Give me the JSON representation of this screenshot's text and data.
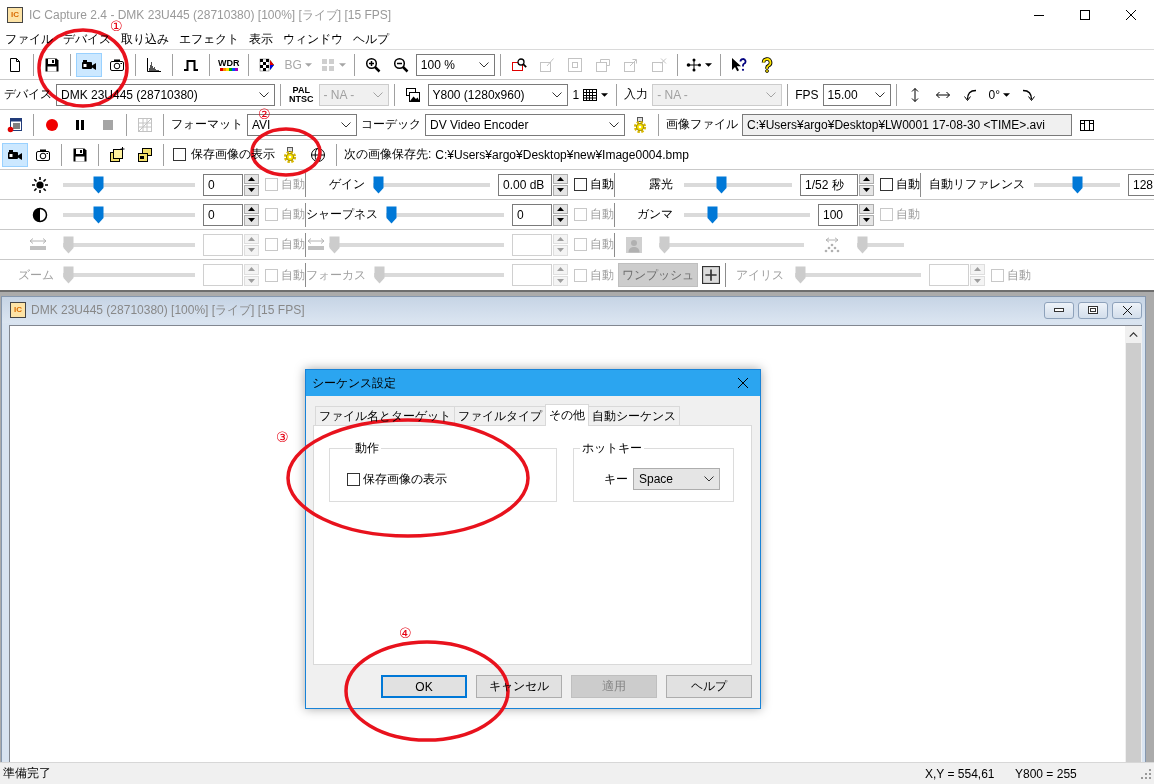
{
  "window": {
    "logo": "IC",
    "title": "IC Capture 2.4 - DMK 23U445 (28710380) [100%] [ライブ] [15 FPS]"
  },
  "menu": [
    "ファイル",
    "デバイス",
    "取り込み",
    "エフェクト",
    "表示",
    "ウィンドウ",
    "ヘルプ"
  ],
  "toolbars": [
    {
      "groups": [
        [
          {
            "kind": "icon_button",
            "selected": false,
            "disabled": false
          }
        ],
        [
          {
            "kind": "icon_button",
            "selected": false,
            "disabled": false
          }
        ],
        [
          {
            "kind": "icon_button",
            "selected": true,
            "disabled": false
          },
          {
            "kind": "icon_button",
            "selected": false,
            "disabled": false
          }
        ],
        [
          {
            "kind": "icon_button",
            "selected": false,
            "disabled": false
          }
        ],
        [
          {
            "kind": "icon_button",
            "selected": false,
            "disabled": false
          }
        ],
        [
          {
            "kind": "text_button",
            "lines": [
              "WDR"
            ],
            "disabled": false
          }
        ],
        [
          {
            "kind": "icon_button",
            "selected": false,
            "disabled": false
          },
          {
            "kind": "menu_button",
            "label": "BG",
            "disabled": true
          },
          {
            "kind": "menu_button",
            "disabled": true
          }
        ],
        [
          {
            "kind": "icon_button",
            "selected": false,
            "disabled": false
          },
          {
            "kind": "icon_button",
            "selected": false,
            "disabled": false
          },
          {
            "kind": "combo",
            "value": "100 %",
            "disabled": false
          }
        ],
        [
          {
            "kind": "icon_button",
            "selected": false,
            "disabled": false
          },
          {
            "kind": "icon_button",
            "selected": false,
            "disabled": true
          },
          {
            "kind": "icon_button",
            "selected": false,
            "disabled": true
          },
          {
            "kind": "icon_button",
            "selected": false,
            "disabled": true
          },
          {
            "kind": "icon_button",
            "selected": false,
            "disabled": true
          },
          {
            "kind": "icon_button",
            "selected": false,
            "disabled": true
          }
        ],
        [
          {
            "kind": "menu_button",
            "disabled": false
          }
        ],
        [
          {
            "kind": "icon_button",
            "selected": false,
            "disabled": false
          },
          {
            "kind": "icon_button",
            "selected": false,
            "disabled": false
          }
        ]
      ]
    },
    {
      "groups": [
        [
          {
            "kind": "label",
            "text": "デバイス"
          },
          {
            "kind": "combo",
            "value": "DMK 23U445 (28710380)",
            "disabled": false
          }
        ],
        [
          {
            "kind": "text_button",
            "lines": [
              "PAL",
              "NTSC"
            ],
            "disabled": false
          },
          {
            "kind": "combo",
            "value": "- NA -",
            "disabled": true
          }
        ],
        [
          {
            "kind": "icon_button",
            "selected": false,
            "disabled": false
          },
          {
            "kind": "combo",
            "value": "Y800 (1280x960)",
            "disabled": false
          },
          {
            "kind": "menu_button",
            "label": "1",
            "disabled": false
          }
        ],
        [
          {
            "kind": "label",
            "text": "入力"
          },
          {
            "kind": "combo",
            "value": "- NA -",
            "disabled": true
          }
        ],
        [
          {
            "kind": "label",
            "text": "FPS"
          },
          {
            "kind": "combo",
            "value": "15.00",
            "disabled": false
          }
        ],
        [
          {
            "kind": "icon_button",
            "selected": false,
            "disabled": false
          },
          {
            "kind": "icon_button",
            "selected": false,
            "disabled": false
          },
          {
            "kind": "icon_button",
            "selected": false,
            "disabled": false
          },
          {
            "kind": "menu_button",
            "label": "0°",
            "disabled": false
          },
          {
            "kind": "icon_button",
            "selected": false,
            "disabled": false
          }
        ]
      ]
    },
    {
      "groups": [
        [
          {
            "kind": "icon_button",
            "selected": false,
            "disabled": false
          }
        ],
        [
          {
            "kind": "icon_button",
            "selected": false,
            "disabled": false
          },
          {
            "kind": "icon_button",
            "selected": false,
            "disabled": false
          },
          {
            "kind": "icon_button",
            "selected": false,
            "disabled": true
          }
        ],
        [
          {
            "kind": "icon_button",
            "selected": false,
            "disabled": true
          }
        ],
        [
          {
            "kind": "label",
            "text": "フォーマット"
          },
          {
            "kind": "combo",
            "value": "AVI",
            "disabled": false
          },
          {
            "kind": "label",
            "text": "コーデック"
          },
          {
            "kind": "combo",
            "value": "DV Video Encoder",
            "disabled": false
          },
          {
            "kind": "icon_button",
            "selected": false,
            "disabled": false
          }
        ],
        [
          {
            "kind": "label",
            "text": "画像ファイル"
          },
          {
            "kind": "field",
            "value": "C:¥Users¥argo¥Desktop¥LW0001 17-08-30 <TIME>.avi",
            "readonly": true
          },
          {
            "kind": "icon_button",
            "selected": false,
            "disabled": false
          }
        ]
      ]
    },
    {
      "groups": [
        [
          {
            "kind": "icon_button",
            "selected": true,
            "disabled": false
          },
          {
            "kind": "icon_button",
            "selected": false,
            "disabled": false
          }
        ],
        [
          {
            "kind": "icon_button",
            "selected": false,
            "disabled": false
          }
        ],
        [
          {
            "kind": "icon_button",
            "selected": false,
            "disabled": false
          },
          {
            "kind": "icon_button",
            "selected": false,
            "disabled": false
          }
        ],
        [
          {
            "kind": "checkbox",
            "label": "保存画像の表示",
            "checked": false
          },
          {
            "kind": "icon_button",
            "selected": false,
            "disabled": false
          },
          {
            "kind": "icon_button",
            "selected": false,
            "disabled": false
          }
        ],
        [
          {
            "kind": "label",
            "text": "次の画像保存先:"
          },
          {
            "kind": "text",
            "text": "C:¥Users¥argo¥Desktop¥new¥Image0004.bmp"
          }
        ]
      ]
    }
  ],
  "slider_panel": {
    "rows": [
      {
        "cells": [
          [
            {
              "kind": "slider",
              "level": 0.25,
              "value": "0",
              "disabled": false,
              "auto": {
                "label": "自動",
                "checked": false,
                "disabled": true
              }
            }
          ],
          [
            {
              "kind": "slider",
              "label": "ゲイン",
              "level": 0,
              "value": "0.00 dB",
              "disabled": false,
              "auto": {
                "label": "自動",
                "checked": false,
                "disabled": false
              }
            }
          ],
          [
            {
              "kind": "slider",
              "label": "露光",
              "level": 0.33,
              "value": "1/52 秒",
              "disabled": false,
              "auto": {
                "label": "自動",
                "checked": false,
                "disabled": false
              }
            }
          ],
          [
            {
              "kind": "slider",
              "label": "自動リファレンス",
              "level": 0.5,
              "value": "128",
              "disabled": false
            }
          ]
        ]
      },
      {
        "cells": [
          [
            {
              "kind": "slider",
              "level": 0.25,
              "value": "0",
              "disabled": false,
              "auto": {
                "label": "自動",
                "checked": false,
                "disabled": true
              }
            }
          ],
          [
            {
              "kind": "slider",
              "label": "シャープネス",
              "level": 0,
              "value": "0",
              "disabled": false,
              "auto": {
                "label": "自動",
                "checked": false,
                "disabled": true
              }
            }
          ],
          [
            {
              "kind": "slider",
              "label": "ガンマ",
              "level": 0.2,
              "value": "100",
              "disabled": false,
              "auto": {
                "label": "自動",
                "checked": false,
                "disabled": true
              }
            }
          ]
        ]
      },
      {
        "cells": [
          [
            {
              "kind": "slider",
              "level": 0,
              "disabled": true,
              "auto": {
                "label": "自動",
                "checked": false,
                "disabled": true
              }
            }
          ],
          [
            {
              "kind": "slider",
              "level": 0,
              "disabled": true,
              "auto": {
                "label": "自動",
                "checked": false,
                "disabled": true
              }
            }
          ],
          [
            {
              "kind": "bare_slider",
              "level": 0,
              "disabled": true
            },
            {
              "kind": "bare_slider",
              "level": 0,
              "disabled": true
            }
          ]
        ]
      },
      {
        "cells": [
          [
            {
              "kind": "slider",
              "label": "ズーム",
              "level": 0,
              "disabled": true,
              "auto": {
                "label": "自動",
                "checked": false,
                "disabled": true
              }
            }
          ],
          [
            {
              "kind": "slider",
              "label": "フォーカス",
              "level": 0,
              "disabled": true,
              "auto": {
                "label": "自動",
                "checked": false,
                "disabled": true
              }
            },
            {
              "kind": "button",
              "label": "ワンプッシュ",
              "disabled": true
            },
            {
              "kind": "icon_button",
              "disabled": false
            }
          ],
          [
            {
              "kind": "slider",
              "label": "アイリス",
              "level": 0,
              "disabled": true,
              "auto": {
                "label": "自動",
                "checked": false,
                "disabled": true
              }
            }
          ]
        ]
      }
    ]
  },
  "document_window": {
    "logo": "IC",
    "title": "DMK 23U445 (28710380) [100%] [ライブ] [15 FPS]"
  },
  "dialog": {
    "title": "シーケンス設定",
    "tabs": [
      {
        "label": "ファイル名とターゲット",
        "selected": false
      },
      {
        "label": "ファイルタイプ",
        "selected": false
      },
      {
        "label": "その他",
        "selected": true
      },
      {
        "label": "自動シーケンス",
        "selected": false
      }
    ],
    "groups": [
      {
        "title": "動作",
        "kind": "checkbox",
        "label": "保存画像の表示",
        "checked": false
      },
      {
        "title": "ホットキー",
        "kind": "select",
        "label": "キー",
        "value": "Space"
      }
    ],
    "buttons": [
      {
        "label": "OK",
        "focused": true,
        "disabled": false
      },
      {
        "label": "キャンセル",
        "focused": false,
        "disabled": false
      },
      {
        "label": "適用",
        "focused": false,
        "disabled": true
      },
      {
        "label": "ヘルプ",
        "focused": false,
        "disabled": false
      }
    ]
  },
  "status_bar": {
    "message": "準備完了",
    "fields": [
      "X,Y = 554,61",
      "Y800 = 255"
    ]
  },
  "annotations": [
    {
      "label": "①"
    },
    {
      "label": "②"
    },
    {
      "label": "③"
    },
    {
      "label": "④"
    }
  ]
}
